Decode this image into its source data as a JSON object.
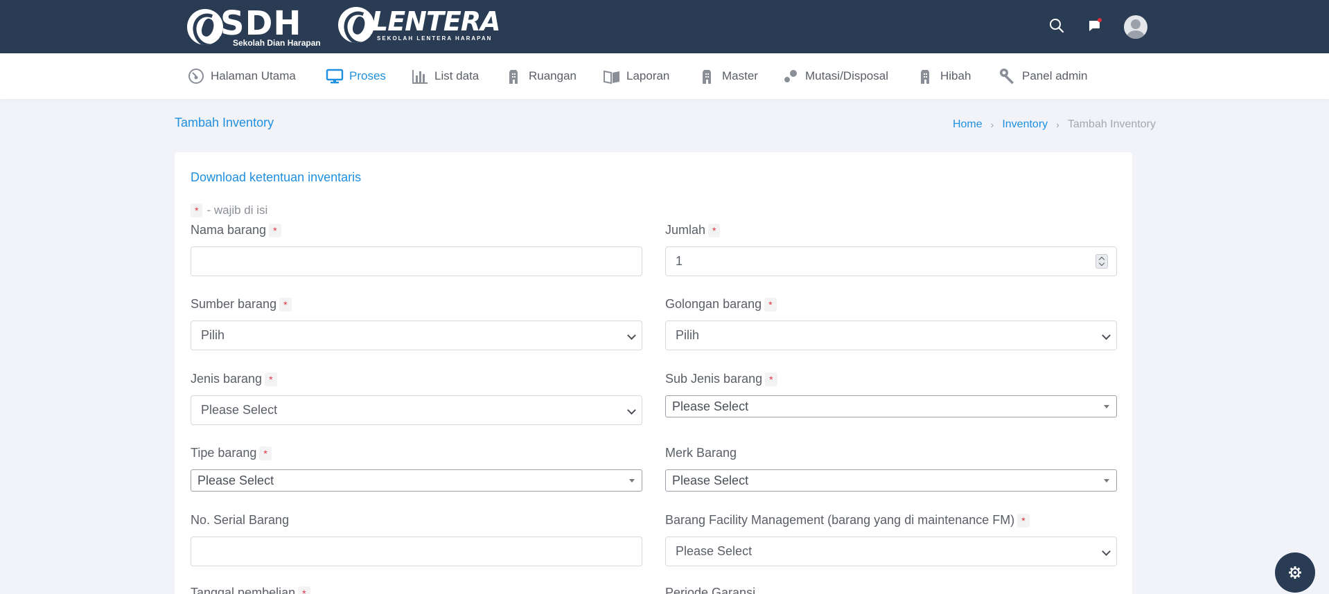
{
  "brand": {
    "sdh_text": "SDH",
    "sdh_subtitle": "Sekolah Dian Harapan",
    "lentera_text": "LENTERA",
    "lentera_subtitle": "SEKOLAH LENTERA HARAPAN"
  },
  "topbar": {
    "icons": [
      "search-icon",
      "chat-icon",
      "avatar"
    ],
    "notification_dot_color": "#e0303f"
  },
  "colors": {
    "header_bg": "#293c53",
    "accent": "#1f8fe0",
    "required": "#e0303f",
    "page_bg": "#f1f3f8"
  },
  "nav": {
    "items": [
      {
        "label": "Halaman Utama",
        "icon": "dashboard-icon"
      },
      {
        "label": "Proses",
        "icon": "monitor-icon",
        "active": true
      },
      {
        "label": "List data",
        "icon": "bar-chart-icon"
      },
      {
        "label": "Ruangan",
        "icon": "building-icon"
      },
      {
        "label": "Laporan",
        "icon": "book-icon"
      },
      {
        "label": "Master",
        "icon": "building-icon"
      },
      {
        "label": "Mutasi/Disposal",
        "icon": "transfer-icon"
      },
      {
        "label": "Hibah",
        "icon": "building-icon"
      },
      {
        "label": "Panel admin",
        "icon": "wrench-icon"
      }
    ]
  },
  "page": {
    "title": "Tambah Inventory",
    "breadcrumb": [
      "Home",
      "Inventory",
      "Tambah Inventory"
    ]
  },
  "form": {
    "download_link": "Download ketentuan inventaris",
    "required_star": "*",
    "required_note": "- wajib di isi",
    "nama_barang": {
      "label": "Nama barang",
      "value": ""
    },
    "jumlah": {
      "label": "Jumlah",
      "value": "1"
    },
    "sumber_barang": {
      "label": "Sumber barang",
      "value": "Pilih"
    },
    "golongan_barang": {
      "label": "Golongan barang",
      "value": "Pilih"
    },
    "jenis_barang": {
      "label": "Jenis barang",
      "value": "Please Select"
    },
    "sub_jenis_barang": {
      "label": "Sub Jenis barang",
      "value": "Please Select"
    },
    "tipe_barang": {
      "label": "Tipe barang",
      "value": "Please Select"
    },
    "merk_barang": {
      "label": "Merk Barang",
      "value": "Please Select"
    },
    "serial_barang": {
      "label": "No. Serial Barang",
      "value": ""
    },
    "barang_fm": {
      "label": "Barang Facility Management (barang yang di maintenance FM)",
      "value": "Please Select"
    },
    "tanggal_pembelian": {
      "label": "Tanggal pembelian"
    },
    "periode_garansi": {
      "label": "Periode Garansi"
    }
  },
  "settings_button": {
    "icon": "gear-icon"
  }
}
